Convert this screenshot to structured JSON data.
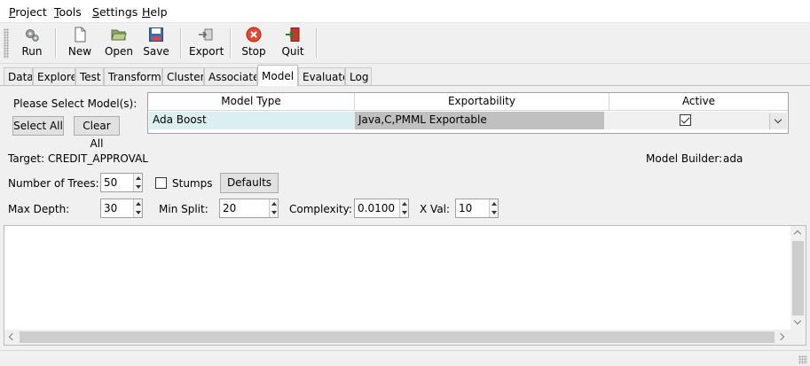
{
  "menu": [
    {
      "label": "Project",
      "hotkey": "P",
      "rest": "roject"
    },
    {
      "label": "Tools",
      "hotkey": "T",
      "rest": "ools"
    },
    {
      "label": "Settings",
      "hotkey": "S",
      "rest": "ettings"
    },
    {
      "label": "Help",
      "hotkey": "H",
      "rest": "elp"
    }
  ],
  "toolbar": {
    "run": "Run",
    "new": "New",
    "open": "Open",
    "save": "Save",
    "export": "Export",
    "stop": "Stop",
    "quit": "Quit"
  },
  "tabs": [
    "Data",
    "Explore",
    "Test",
    "Transform",
    "Cluster",
    "Associate",
    "Model",
    "Evaluate",
    "Log"
  ],
  "active_tab": "Model",
  "model": {
    "select_label": "Please Select Model(s):",
    "select_all": "Select All",
    "clear_all": "Clear All",
    "grid_headers": [
      "Model Type",
      "Exportability",
      "Active"
    ],
    "grid_row": {
      "model_type": "Ada Boost",
      "exportability": "Java,C,PMML Exportable",
      "active": true
    },
    "target_label": "Target: CREDIT_APPROVAL",
    "builder_label": "Model Builder:",
    "builder_value": "ada",
    "trees_label": "Number of Trees:",
    "trees_value": "50",
    "stumps_label": "Stumps",
    "stumps_checked": false,
    "defaults": "Defaults",
    "depth_label": "Max Depth:",
    "depth_value": "30",
    "minsplit_label": "Min Split:",
    "minsplit_value": "20",
    "complexity_label": "Complexity:",
    "complexity_value": "0.0100",
    "xval_label": "X Val:",
    "xval_value": "10"
  },
  "colors": {
    "stop_red": "#e04a2e",
    "grid_selected": "#dceff0",
    "grid_gray": "#c0c0c0"
  }
}
